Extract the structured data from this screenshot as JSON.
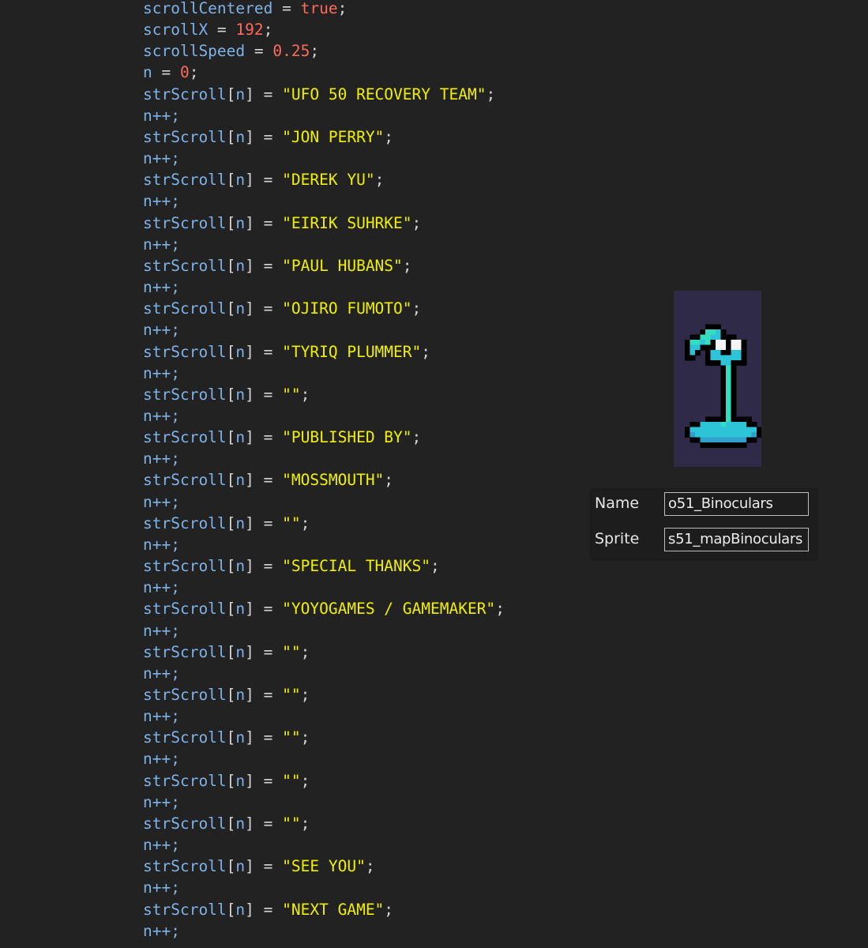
{
  "code": {
    "lines": [
      {
        "kind": "assign",
        "target": "scrollCentered",
        "value": "true",
        "value_type": "kw"
      },
      {
        "kind": "assign",
        "target": "scrollX",
        "value": "192",
        "value_type": "num"
      },
      {
        "kind": "assign",
        "target": "scrollSpeed",
        "value": "0.25",
        "value_type": "num"
      },
      {
        "kind": "assign",
        "target": "n",
        "value": "0",
        "value_type": "num"
      },
      {
        "kind": "assign",
        "target": "strScroll[n]",
        "value": "\"UFO 50 RECOVERY TEAM\"",
        "value_type": "str"
      },
      {
        "kind": "incr",
        "text": "n++;"
      },
      {
        "kind": "assign",
        "target": "strScroll[n]",
        "value": "\"JON PERRY\"",
        "value_type": "str"
      },
      {
        "kind": "incr",
        "text": "n++;"
      },
      {
        "kind": "assign",
        "target": "strScroll[n]",
        "value": "\"DEREK YU\"",
        "value_type": "str"
      },
      {
        "kind": "incr",
        "text": "n++;"
      },
      {
        "kind": "assign",
        "target": "strScroll[n]",
        "value": "\"EIRIK SUHRKE\"",
        "value_type": "str"
      },
      {
        "kind": "incr",
        "text": "n++;"
      },
      {
        "kind": "assign",
        "target": "strScroll[n]",
        "value": "\"PAUL HUBANS\"",
        "value_type": "str"
      },
      {
        "kind": "incr",
        "text": "n++;"
      },
      {
        "kind": "assign",
        "target": "strScroll[n]",
        "value": "\"OJIRO FUMOTO\"",
        "value_type": "str"
      },
      {
        "kind": "incr",
        "text": "n++;"
      },
      {
        "kind": "assign",
        "target": "strScroll[n]",
        "value": "\"TYRIQ PLUMMER\"",
        "value_type": "str"
      },
      {
        "kind": "incr",
        "text": "n++;"
      },
      {
        "kind": "assign",
        "target": "strScroll[n]",
        "value": "\"\"",
        "value_type": "str"
      },
      {
        "kind": "incr",
        "text": "n++;"
      },
      {
        "kind": "assign",
        "target": "strScroll[n]",
        "value": "\"PUBLISHED BY\"",
        "value_type": "str"
      },
      {
        "kind": "incr",
        "text": "n++;"
      },
      {
        "kind": "assign",
        "target": "strScroll[n]",
        "value": "\"MOSSMOUTH\"",
        "value_type": "str"
      },
      {
        "kind": "incr",
        "text": "n++;"
      },
      {
        "kind": "assign",
        "target": "strScroll[n]",
        "value": "\"\"",
        "value_type": "str"
      },
      {
        "kind": "incr",
        "text": "n++;"
      },
      {
        "kind": "assign",
        "target": "strScroll[n]",
        "value": "\"SPECIAL THANKS\"",
        "value_type": "str"
      },
      {
        "kind": "incr",
        "text": "n++;"
      },
      {
        "kind": "assign",
        "target": "strScroll[n]",
        "value": "\"YOYOGAMES / GAMEMAKER\"",
        "value_type": "str"
      },
      {
        "kind": "incr",
        "text": "n++;"
      },
      {
        "kind": "assign",
        "target": "strScroll[n]",
        "value": "\"\"",
        "value_type": "str"
      },
      {
        "kind": "incr",
        "text": "n++;"
      },
      {
        "kind": "assign",
        "target": "strScroll[n]",
        "value": "\"\"",
        "value_type": "str"
      },
      {
        "kind": "incr",
        "text": "n++;"
      },
      {
        "kind": "assign",
        "target": "strScroll[n]",
        "value": "\"\"",
        "value_type": "str"
      },
      {
        "kind": "incr",
        "text": "n++;"
      },
      {
        "kind": "assign",
        "target": "strScroll[n]",
        "value": "\"\"",
        "value_type": "str"
      },
      {
        "kind": "incr",
        "text": "n++;"
      },
      {
        "kind": "assign",
        "target": "strScroll[n]",
        "value": "\"\"",
        "value_type": "str"
      },
      {
        "kind": "incr",
        "text": "n++;"
      },
      {
        "kind": "assign",
        "target": "strScroll[n]",
        "value": "\"SEE YOU\"",
        "value_type": "str"
      },
      {
        "kind": "incr",
        "text": "n++;"
      },
      {
        "kind": "assign",
        "target": "strScroll[n]",
        "value": "\"NEXT GAME\"",
        "value_type": "str"
      },
      {
        "kind": "incr",
        "text": "n++;"
      }
    ]
  },
  "object_panel": {
    "sprite_icon": "binoculars-sprite",
    "name_label": "Name",
    "name_value": "o51_Binoculars",
    "sprite_label": "Sprite",
    "sprite_value": "s51_mapBinoculars"
  },
  "colors": {
    "background": "#222222",
    "identifier": "#7eb3e8",
    "keyword_number": "#ff6a5c",
    "string": "#f0f000",
    "operator": "#d6d6d6",
    "sprite_background": "#2e2a48"
  }
}
